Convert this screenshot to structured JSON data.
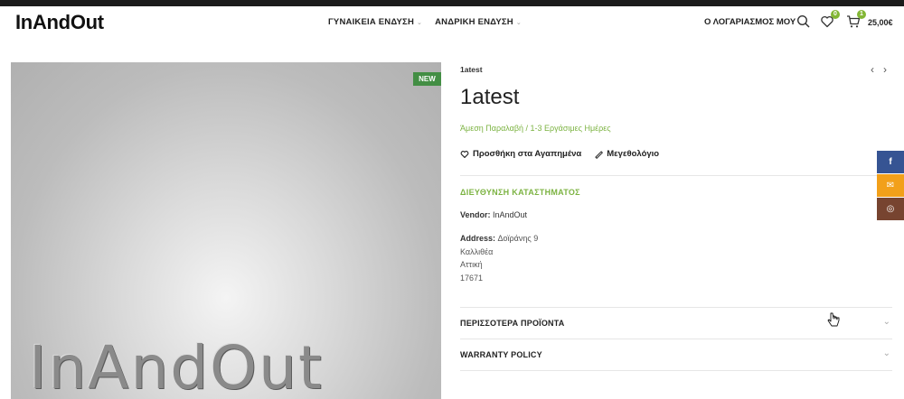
{
  "header": {
    "logo": "InAndOut",
    "nav": [
      {
        "label": "ΓΥΝΑΙΚΕΙΑ ΕΝΔΥΣΗ"
      },
      {
        "label": "ΑΝΔΡΙΚΗ ΕΝΔΥΣΗ"
      }
    ],
    "account_label": "Ο ΛΟΓΑΡΙΑΣΜΟΣ ΜΟΥ",
    "wishlist_count": "0",
    "cart_count": "1",
    "cart_total": "25,00€",
    "icons": {
      "search": "search-icon",
      "wishlist": "heart-icon",
      "cart": "cart-icon"
    }
  },
  "product": {
    "image_brand_text": "InAndOut",
    "badge": "NEW",
    "breadcrumb": "1atest",
    "title": "1atest",
    "delivery": "Άμεση Παραλαβή / 1-3 Εργάσιμες Ημέρες",
    "actions": {
      "wishlist": "Προσθήκη στα Αγαπημένα",
      "size_guide": "Μεγεθολόγιο"
    },
    "store": {
      "heading": "ΔΙΕΥΘΥΝΣΗ ΚΑΤΑΣΤΗΜΑΤΟΣ",
      "vendor_label": "Vendor:",
      "vendor_value": "InAndOut",
      "address_label": "Address:",
      "address_lines": [
        "Δοϊράνης 9",
        "Καλλιθέα",
        "Αττική",
        "17671"
      ]
    },
    "accordions": [
      {
        "label": "ΠΕΡΙΣΣΟΤΕΡΑ ΠΡΟΪΟΝΤΑ"
      },
      {
        "label": "WARRANTY POLICY"
      }
    ]
  },
  "social": [
    {
      "name": "facebook",
      "glyph": "f"
    },
    {
      "name": "email",
      "glyph": "✉"
    },
    {
      "name": "instagram",
      "glyph": "◎"
    }
  ],
  "colors": {
    "accent_green": "#7cb342",
    "badge_green": "#438e44",
    "facebook": "#365493",
    "email": "#f2a01a",
    "instagram": "#774430"
  }
}
